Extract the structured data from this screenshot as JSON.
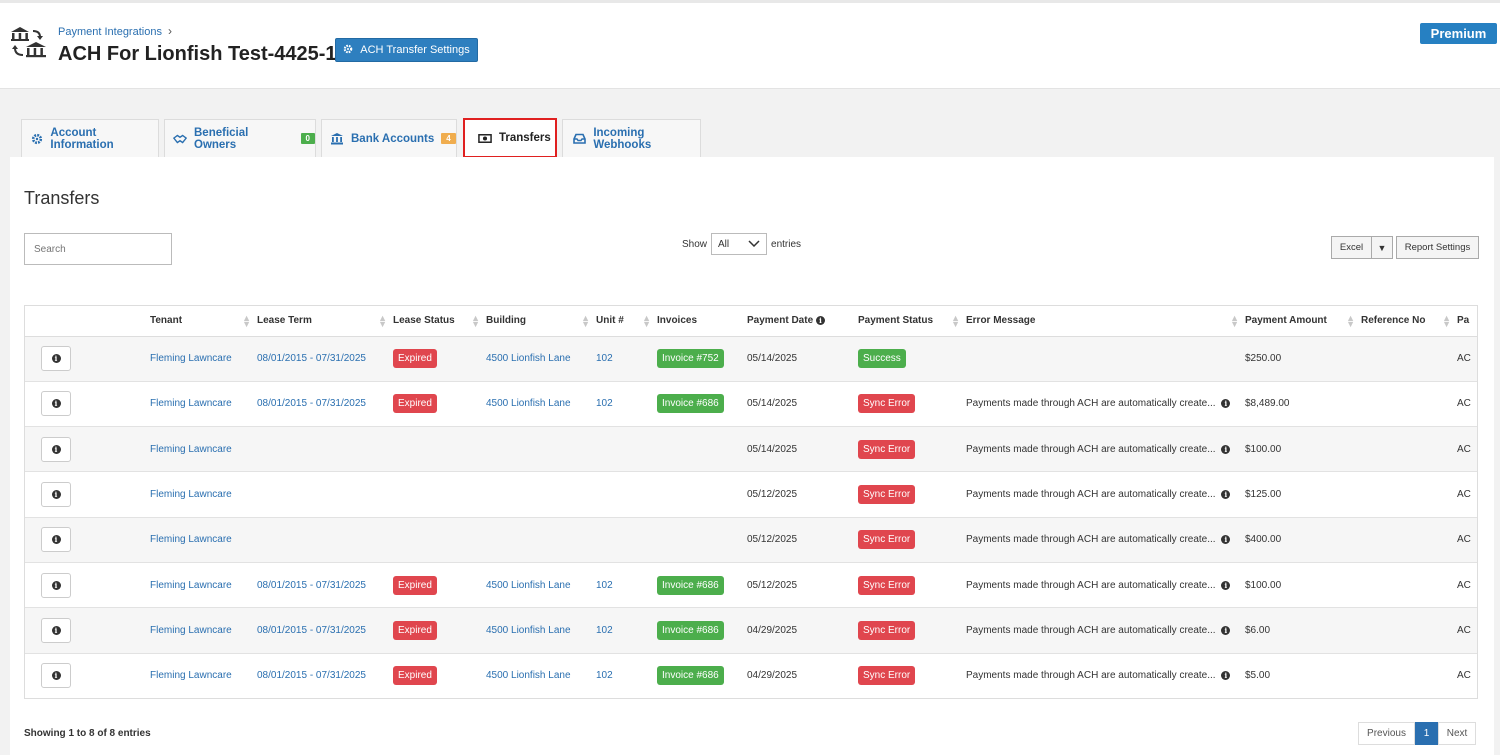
{
  "header": {
    "breadcrumb": "Payment Integrations",
    "breadcrumb_sep": "›",
    "title": "ACH For Lionfish Test-4425-1",
    "settings_button": "ACH Transfer Settings",
    "premium": "Premium"
  },
  "tabs": [
    {
      "label": "Account Information",
      "icon": "gear-icon"
    },
    {
      "label": "Beneficial Owners",
      "icon": "handshake-icon",
      "badge": "0",
      "badge_color": "#4cae4c"
    },
    {
      "label": "Bank Accounts",
      "icon": "bank-icon",
      "badge": "4",
      "badge_color": "#f0ad4e"
    },
    {
      "label": "Transfers",
      "icon": "money-icon",
      "active": true
    },
    {
      "label": "Incoming Webhooks",
      "icon": "inbox-icon"
    }
  ],
  "section_title": "Transfers",
  "search": {
    "placeholder": "Search"
  },
  "show": {
    "prefix": "Show",
    "value": "All",
    "suffix": "entries"
  },
  "toolbar": {
    "excel": "Excel",
    "caret": "▼",
    "report_settings": "Report Settings"
  },
  "columns": [
    "",
    "Tenant",
    "Lease Term",
    "Lease Status",
    "Building",
    "Unit #",
    "Invoices",
    "Payment Date",
    "Payment Status",
    "Error Message",
    "Payment Amount",
    "Reference No",
    "Pa"
  ],
  "rows": [
    {
      "tenant": "Fleming Lawncare",
      "lease_term": "08/01/2015 - 07/31/2025",
      "lease_status": "Expired",
      "building": "4500 Lionfish Lane",
      "unit": "102",
      "invoice": "Invoice #752",
      "date": "05/14/2025",
      "status": "Success",
      "error": "",
      "amount": "$250.00",
      "ref": "",
      "pa": "AC"
    },
    {
      "tenant": "Fleming Lawncare",
      "lease_term": "08/01/2015 - 07/31/2025",
      "lease_status": "Expired",
      "building": "4500 Lionfish Lane",
      "unit": "102",
      "invoice": "Invoice #686",
      "date": "05/14/2025",
      "status": "Sync Error",
      "error": "Payments made through ACH are automatically create...",
      "amount": "$8,489.00",
      "ref": "",
      "pa": "AC"
    },
    {
      "tenant": "Fleming Lawncare",
      "lease_term": "",
      "lease_status": "",
      "building": "",
      "unit": "",
      "invoice": "",
      "date": "05/14/2025",
      "status": "Sync Error",
      "error": "Payments made through ACH are automatically create...",
      "amount": "$100.00",
      "ref": "",
      "pa": "AC"
    },
    {
      "tenant": "Fleming Lawncare",
      "lease_term": "",
      "lease_status": "",
      "building": "",
      "unit": "",
      "invoice": "",
      "date": "05/12/2025",
      "status": "Sync Error",
      "error": "Payments made through ACH are automatically create...",
      "amount": "$125.00",
      "ref": "",
      "pa": "AC"
    },
    {
      "tenant": "Fleming Lawncare",
      "lease_term": "",
      "lease_status": "",
      "building": "",
      "unit": "",
      "invoice": "",
      "date": "05/12/2025",
      "status": "Sync Error",
      "error": "Payments made through ACH are automatically create...",
      "amount": "$400.00",
      "ref": "",
      "pa": "AC"
    },
    {
      "tenant": "Fleming Lawncare",
      "lease_term": "08/01/2015 - 07/31/2025",
      "lease_status": "Expired",
      "building": "4500 Lionfish Lane",
      "unit": "102",
      "invoice": "Invoice #686",
      "date": "05/12/2025",
      "status": "Sync Error",
      "error": "Payments made through ACH are automatically create...",
      "amount": "$100.00",
      "ref": "",
      "pa": "AC"
    },
    {
      "tenant": "Fleming Lawncare",
      "lease_term": "08/01/2015 - 07/31/2025",
      "lease_status": "Expired",
      "building": "4500 Lionfish Lane",
      "unit": "102",
      "invoice": "Invoice #686",
      "date": "04/29/2025",
      "status": "Sync Error",
      "error": "Payments made through ACH are automatically create...",
      "amount": "$6.00",
      "ref": "",
      "pa": "AC"
    },
    {
      "tenant": "Fleming Lawncare",
      "lease_term": "08/01/2015 - 07/31/2025",
      "lease_status": "Expired",
      "building": "4500 Lionfish Lane",
      "unit": "102",
      "invoice": "Invoice #686",
      "date": "04/29/2025",
      "status": "Sync Error",
      "error": "Payments made through ACH are automatically create...",
      "amount": "$5.00",
      "ref": "",
      "pa": "AC"
    }
  ],
  "footer": {
    "showing": "Showing 1 to 8 of 8 entries",
    "previous": "Previous",
    "page": "1",
    "next": "Next"
  },
  "colors": {
    "primary": "#2e7fbf",
    "danger": "#e0464e",
    "success": "#4cae4c",
    "warning": "#f0ad4e",
    "active_outline": "#e02020"
  }
}
